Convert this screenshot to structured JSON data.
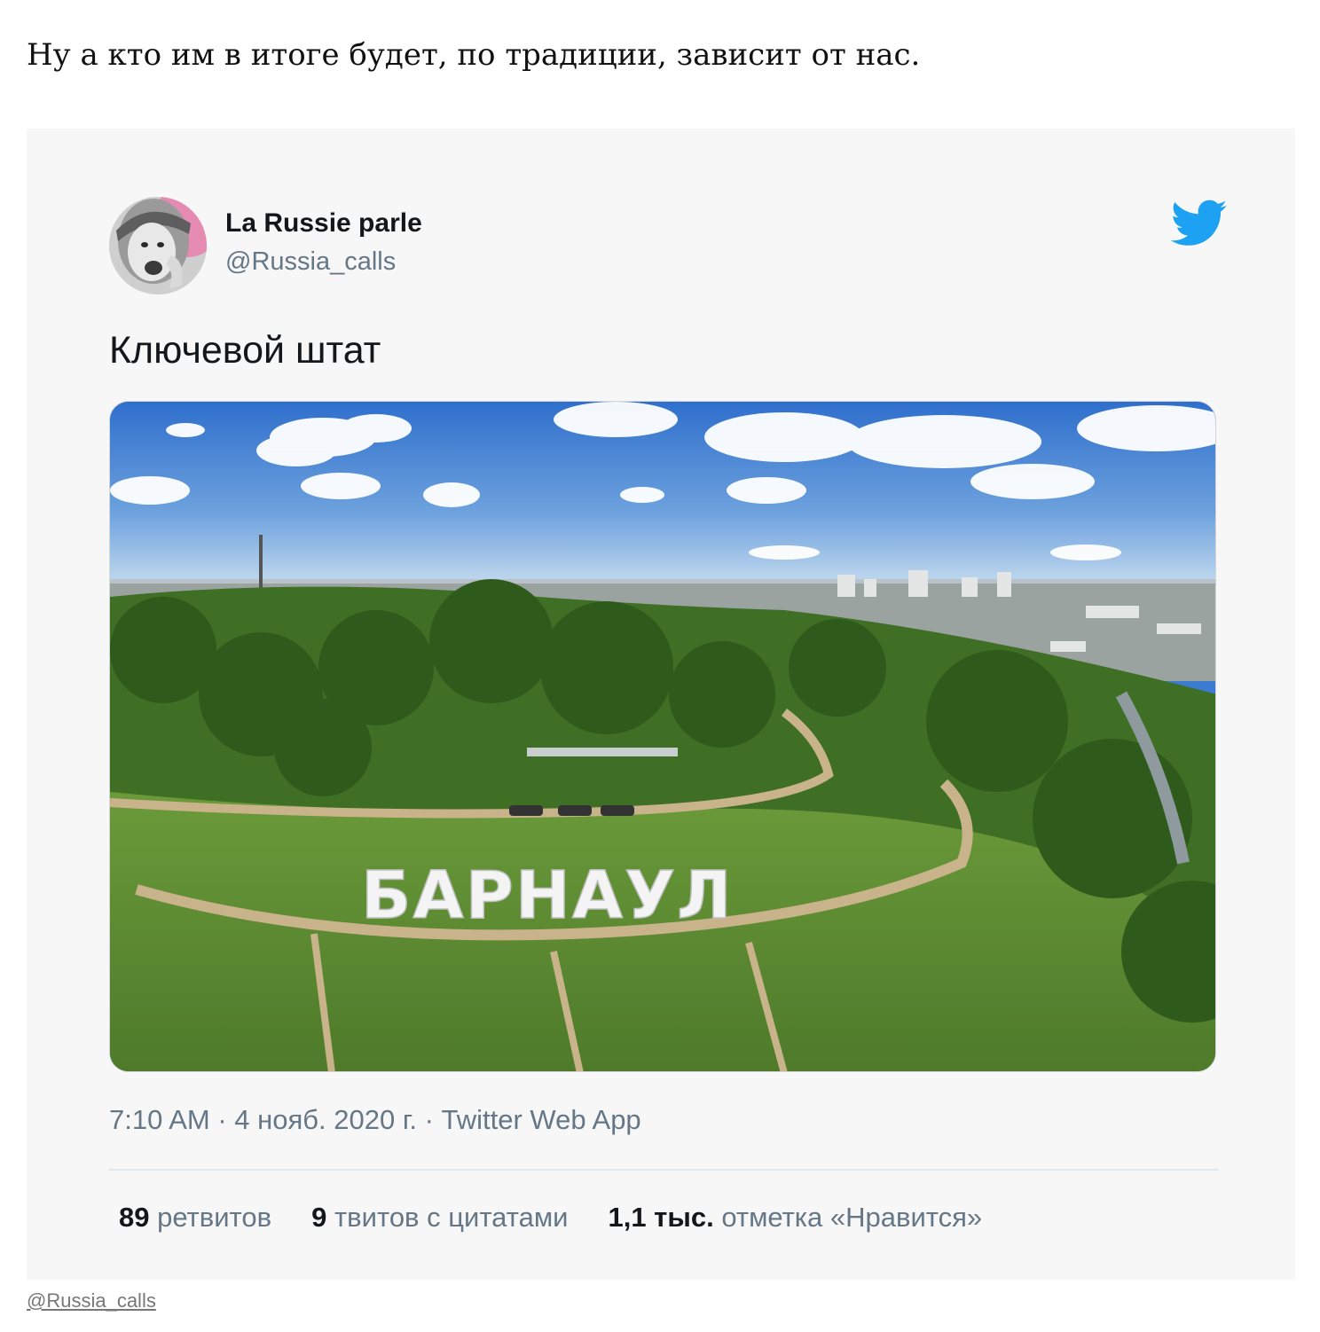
{
  "article": {
    "lead_text": "Ну а кто им в итоге будет, по традиции, зависит от нас."
  },
  "tweet": {
    "author_name": "La Russie parle",
    "author_handle": "@Russia_calls",
    "text": "Ключевой штат",
    "photo_sign_text": "БАРНАУЛ",
    "timestamp": "7:10 AM · 4 нояб. 2020 г. · Twitter Web App",
    "stats": [
      {
        "count": "89",
        "label": "ретвитов"
      },
      {
        "count": "9",
        "label": "твитов с цитатами"
      },
      {
        "count": "1,1 тыс.",
        "label": "отметка «Нравится»"
      }
    ],
    "icons": {
      "brand": "twitter-bird-icon"
    },
    "colors": {
      "twitter_blue": "#1da1f2",
      "secondary_text": "#657786",
      "embed_background": "#f7f7f7"
    }
  },
  "footer": {
    "credit_link": "@Russia_calls"
  }
}
